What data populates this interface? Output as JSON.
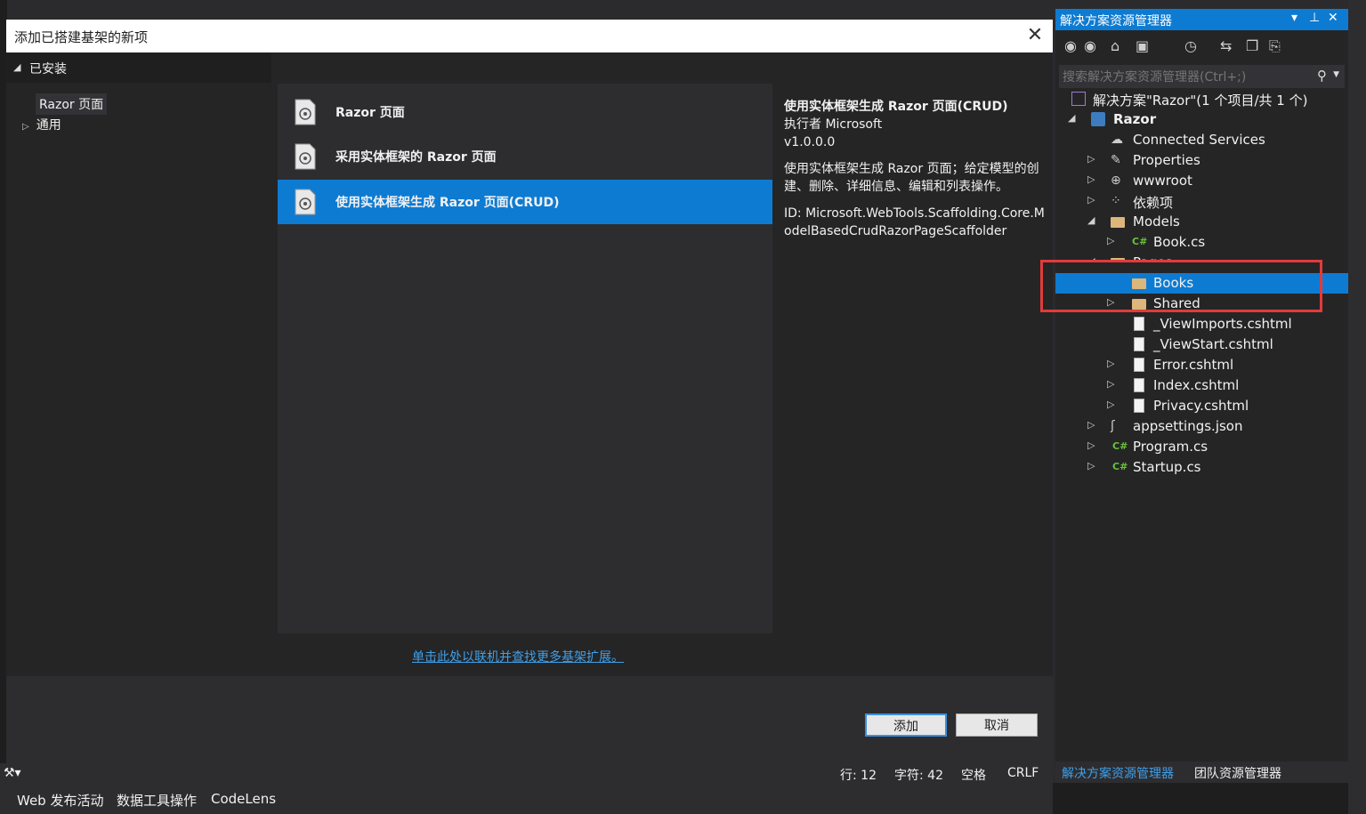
{
  "dialog": {
    "title": "添加已搭建基架的新项",
    "close_glyph": "✕",
    "tree": {
      "installed": "已安装",
      "razor_pages": "Razor 页面",
      "general": "通用"
    },
    "templates": [
      {
        "name": "Razor 页面"
      },
      {
        "name": "采用实体框架的 Razor 页面"
      },
      {
        "name": "使用实体框架生成 Razor 页面(CRUD)"
      }
    ],
    "detail": {
      "title": "使用实体框架生成 Razor 页面(CRUD)",
      "author": "执行者 Microsoft",
      "version": "v1.0.0.0",
      "description": "使用实体框架生成 Razor 页面；给定模型的创建、删除、详细信息、编辑和列表操作。",
      "id": "ID: Microsoft.WebTools.Scaffolding.Core.ModelBasedCrudRazorPageScaffolder"
    },
    "online_link": "单击此处以联机并查找更多基架扩展。",
    "buttons": {
      "add": "添加",
      "cancel": "取消"
    }
  },
  "status_bar": {
    "line": "行: 12",
    "char": "字符: 42",
    "spaces": "空格",
    "eol": "CRLF"
  },
  "bottom_tabs": [
    "Web 发布活动",
    "数据工具操作",
    "CodeLens"
  ],
  "solution_explorer": {
    "title": "解决方案资源管理器",
    "search_placeholder": "搜索解决方案资源管理器(Ctrl+;)",
    "items": [
      {
        "label": "解决方案\"Razor\"(1 个项目/共 1 个)",
        "icon": "solution-icon"
      },
      {
        "label": "Razor",
        "icon": "web-project-icon"
      },
      {
        "label": "Connected Services",
        "icon": "cloud-icon"
      },
      {
        "label": "Properties",
        "icon": "wrench-icon"
      },
      {
        "label": "wwwroot",
        "icon": "globe-icon"
      },
      {
        "label": "依赖项",
        "icon": "dependencies-icon"
      },
      {
        "label": "Models",
        "icon": "folder-icon"
      },
      {
        "label": "Book.cs",
        "icon": "csharp-icon"
      },
      {
        "label": "Pages",
        "icon": "folder-icon"
      },
      {
        "label": "Books",
        "icon": "folder-icon"
      },
      {
        "label": "Shared",
        "icon": "folder-icon"
      },
      {
        "label": "_ViewImports.cshtml",
        "icon": "razor-file-icon"
      },
      {
        "label": "_ViewStart.cshtml",
        "icon": "razor-file-icon"
      },
      {
        "label": "Error.cshtml",
        "icon": "razor-file-icon"
      },
      {
        "label": "Index.cshtml",
        "icon": "razor-file-icon"
      },
      {
        "label": "Privacy.cshtml",
        "icon": "razor-file-icon"
      },
      {
        "label": "appsettings.json",
        "icon": "json-icon"
      },
      {
        "label": "Program.cs",
        "icon": "csharp-icon"
      },
      {
        "label": "Startup.cs",
        "icon": "csharp-icon"
      }
    ],
    "tabs": [
      "解决方案资源管理器",
      "团队资源管理器"
    ]
  },
  "colors": {
    "accent": "#0e7bd2",
    "highlight": "#e23b3b"
  }
}
